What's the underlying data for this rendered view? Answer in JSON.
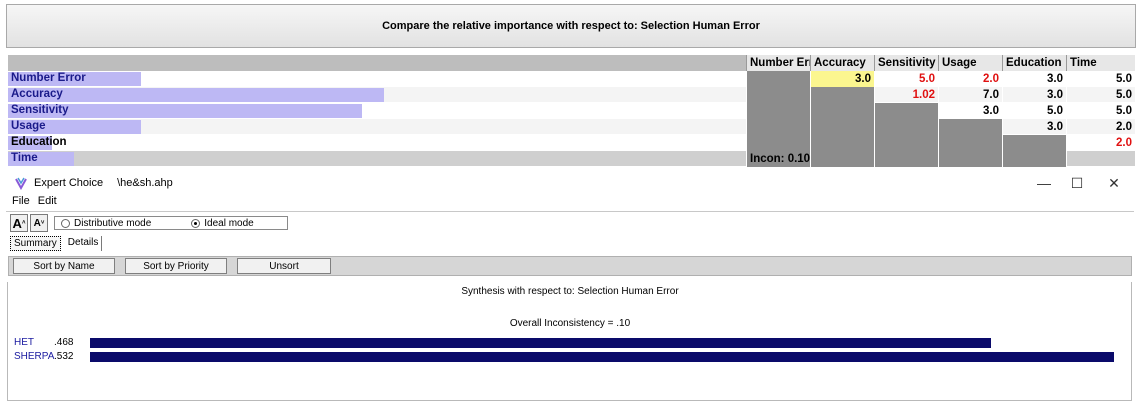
{
  "comparison": {
    "header": "Compare the relative importance with respect to: Selection Human Error"
  },
  "matrix": {
    "columns": [
      "Number Err",
      "Accuracy",
      "Sensitivity",
      "Usage",
      "Education",
      "Time"
    ],
    "rows": [
      {
        "label": "Number Error",
        "weight": 0.18,
        "cells": [
          "",
          "3.0",
          "5.0",
          "2.0",
          "3.0",
          "5.0"
        ],
        "colors": [
          "gray",
          "yellow",
          "red",
          "red",
          "black",
          "black"
        ]
      },
      {
        "label": "Accuracy",
        "weight": 0.51,
        "cells": [
          "",
          "",
          "1.02",
          "7.0",
          "3.0",
          "5.0"
        ],
        "colors": [
          "gray",
          "gray",
          "red",
          "black",
          "black",
          "black"
        ]
      },
      {
        "label": "Sensitivity",
        "weight": 0.48,
        "cells": [
          "",
          "",
          "",
          "3.0",
          "5.0",
          "5.0"
        ],
        "colors": [
          "gray",
          "gray",
          "gray",
          "black",
          "black",
          "black"
        ]
      },
      {
        "label": "Usage",
        "weight": 0.18,
        "cells": [
          "",
          "",
          "",
          "",
          "3.0",
          "2.0"
        ],
        "colors": [
          "gray",
          "gray",
          "gray",
          "gray",
          "black",
          "black"
        ]
      },
      {
        "label": "Education",
        "weight": 0.06,
        "cells": [
          "",
          "",
          "",
          "",
          "",
          "2.0"
        ],
        "colors": [
          "gray",
          "gray",
          "gray",
          "gray",
          "gray",
          "red"
        ]
      },
      {
        "label": "Time",
        "weight": 0.09,
        "cells": [
          "Incon: 0.10",
          "",
          "",
          "",
          "",
          ""
        ],
        "colors": [
          "gray",
          "gray",
          "gray",
          "gray",
          "gray",
          "none"
        ]
      }
    ]
  },
  "window": {
    "app_name": "Expert Choice",
    "file_path": "\\he&sh.ahp",
    "minimize": "—",
    "maximize": "☐",
    "close": "✕"
  },
  "menu": {
    "file": "File",
    "edit": "Edit"
  },
  "toolbar": {
    "font_up": "A",
    "font_down": "A",
    "distributive_mode": "Distributive mode",
    "ideal_mode": "Ideal mode",
    "selected_mode": "ideal"
  },
  "tabs": {
    "summary": "Summary",
    "details": "Details"
  },
  "sort": {
    "by_name": "Sort by Name",
    "by_priority": "Sort by Priority",
    "unsort": "Unsort"
  },
  "synthesis": {
    "title": "Synthesis with respect to: Selection Human Error",
    "inconsistency": "Overall Inconsistency = .10",
    "alternatives": [
      {
        "name": "HET",
        "value": ".468",
        "weight": 0.468
      },
      {
        "name": "SHERPA",
        "value": ".532",
        "weight": 0.532
      }
    ]
  },
  "colors": {
    "priority_bar": "#bdb8f4",
    "synthesis_bar": "#0a0a6a",
    "highlight_cell": "#fbf68f",
    "inverse_value": "#e01010"
  }
}
